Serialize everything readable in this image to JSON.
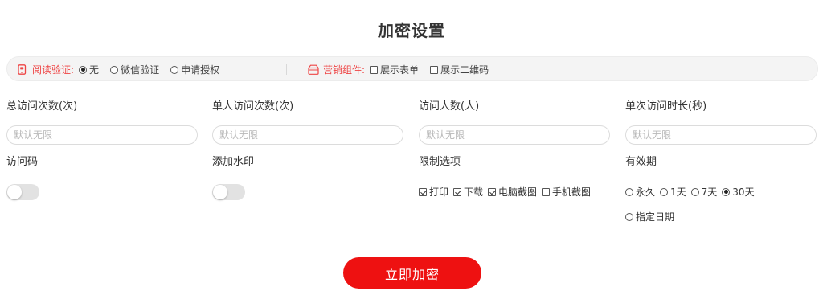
{
  "page_title": "加密设置",
  "options_bar": {
    "read_verify": {
      "icon": "phone-lock-icon",
      "label": "阅读验证:",
      "options": [
        {
          "label": "无",
          "selected": true
        },
        {
          "label": "微信验证",
          "selected": false
        },
        {
          "label": "申请授权",
          "selected": false
        }
      ]
    },
    "marketing": {
      "icon": "gift-icon",
      "label": "营销组件:",
      "options": [
        {
          "label": "展示表单",
          "checked": false
        },
        {
          "label": "展示二维码",
          "checked": false
        }
      ]
    }
  },
  "fields": {
    "total_visits": {
      "label": "总访问次数(次)",
      "placeholder": "默认无限"
    },
    "per_person_visits": {
      "label": "单人访问次数(次)",
      "placeholder": "默认无限"
    },
    "visitor_count": {
      "label": "访问人数(人)",
      "placeholder": "默认无限"
    },
    "single_duration": {
      "label": "单次访问时长(秒)",
      "placeholder": "默认无限"
    }
  },
  "access_code": {
    "label": "访问码",
    "enabled": false
  },
  "watermark": {
    "label": "添加水印",
    "enabled": false
  },
  "restrictions": {
    "label": "限制选项",
    "options": [
      {
        "label": "打印",
        "checked": true
      },
      {
        "label": "下载",
        "checked": true
      },
      {
        "label": "电脑截图",
        "checked": true
      },
      {
        "label": "手机截图",
        "checked": false
      }
    ]
  },
  "validity": {
    "label": "有效期",
    "options": [
      {
        "label": "永久",
        "selected": false
      },
      {
        "label": "1天",
        "selected": false
      },
      {
        "label": "7天",
        "selected": false
      },
      {
        "label": "30天",
        "selected": true
      },
      {
        "label": "指定日期",
        "selected": false
      }
    ]
  },
  "submit_label": "立即加密",
  "colors": {
    "accent": "#ee1111",
    "label_red": "#ee4444",
    "bar_bg": "#f4f4f4"
  }
}
